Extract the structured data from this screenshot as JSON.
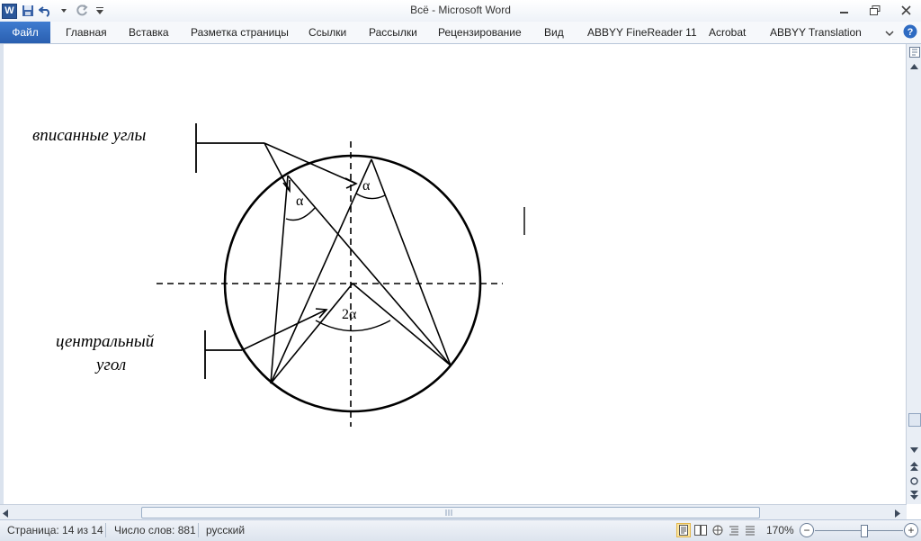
{
  "window": {
    "title": "Всё  -  Microsoft Word"
  },
  "qat": {
    "logo_letter": "W"
  },
  "ribbon": {
    "tabs": [
      {
        "label": "Файл"
      },
      {
        "label": "Главная"
      },
      {
        "label": "Вставка"
      },
      {
        "label": "Разметка страницы"
      },
      {
        "label": "Ссылки"
      },
      {
        "label": "Рассылки"
      },
      {
        "label": "Рецензирование"
      },
      {
        "label": "Вид"
      },
      {
        "label": "ABBYY FineReader 11"
      },
      {
        "label": "Acrobat"
      },
      {
        "label": "ABBYY Translation"
      }
    ]
  },
  "document": {
    "diagram": {
      "label_inscribed": "вписанные углы",
      "label_central_line1": "центральный",
      "label_central_line2": "угол",
      "angle_alpha_1": "α",
      "angle_alpha_2": "α",
      "angle_central": "2α"
    }
  },
  "status": {
    "page": "Страница: 14 из 14",
    "words": "Число слов: 881",
    "language": "русский",
    "zoom": "170%",
    "zoom_minus": "−",
    "zoom_plus": "+"
  },
  "colors": {
    "file_tab": "#2a5fb0",
    "accent": "#2b579a"
  }
}
